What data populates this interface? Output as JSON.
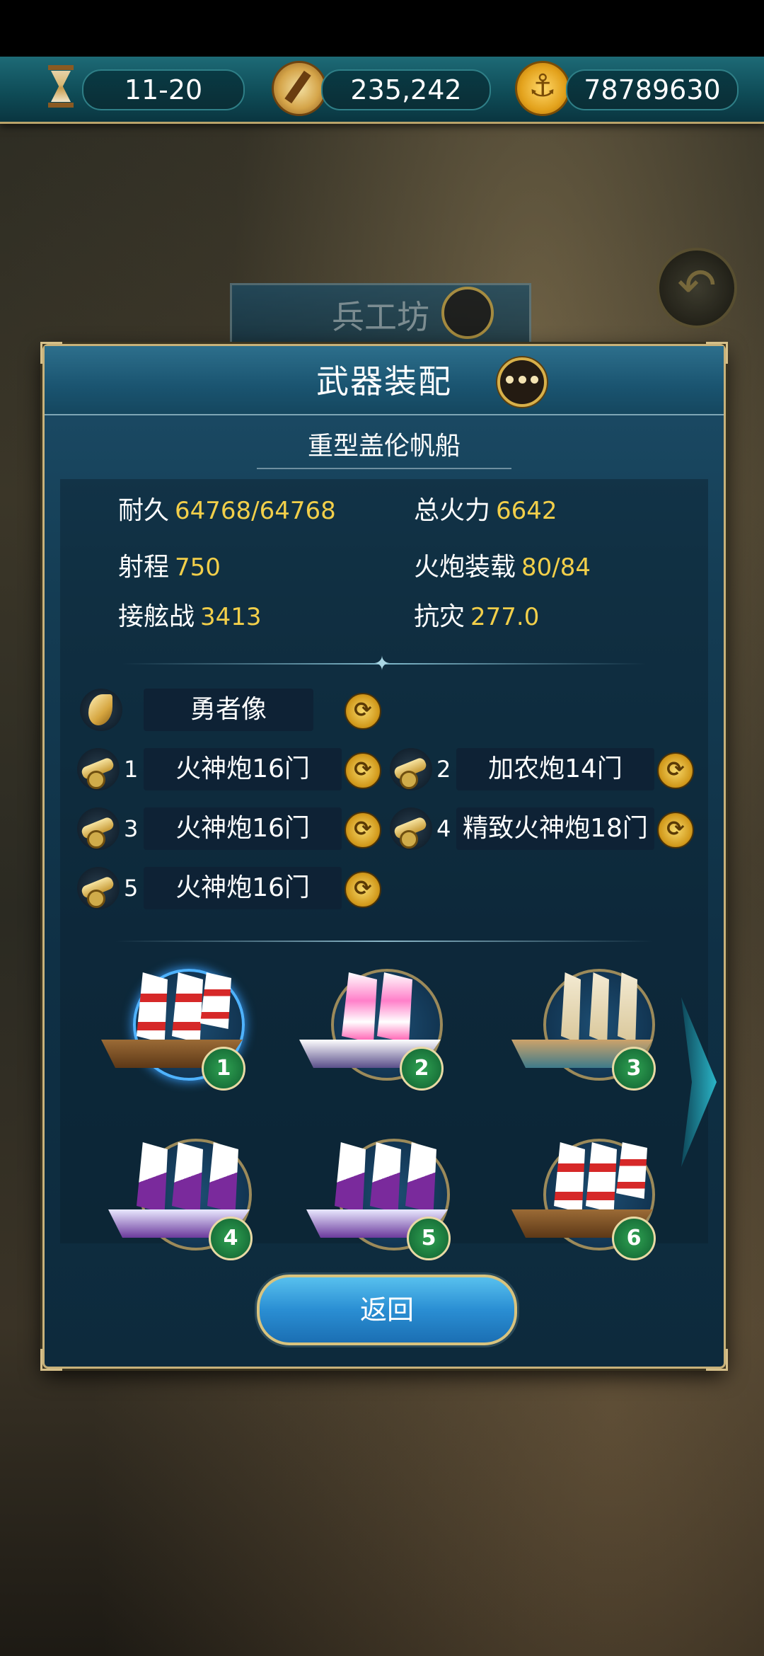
{
  "resources": {
    "turn": "11-20",
    "compass_value": "235,242",
    "gold_value": "78789630"
  },
  "background": {
    "workshop_title": "兵工坊"
  },
  "panel": {
    "title": "武器装配",
    "ship_name": "重型盖伦帆船",
    "stats": [
      {
        "label": "耐久",
        "value": "64768/64768"
      },
      {
        "label": "总火力",
        "value": "6642"
      },
      {
        "label": "射程",
        "value": "750"
      },
      {
        "label": "火炮装载",
        "value": "80/84"
      },
      {
        "label": "接舷战",
        "value": "3413"
      },
      {
        "label": "抗灾",
        "value": "277.0"
      }
    ],
    "figurehead": "勇者像",
    "cannon_slots": [
      {
        "num": "1",
        "name": "火神炮16门"
      },
      {
        "num": "2",
        "name": "加农炮14门"
      },
      {
        "num": "3",
        "name": "火神炮16门"
      },
      {
        "num": "4",
        "name": "精致火神炮18门"
      },
      {
        "num": "5",
        "name": "火神炮16门"
      }
    ],
    "ships": [
      "1",
      "2",
      "3",
      "4",
      "5",
      "6"
    ],
    "return_label": "返回"
  },
  "icons": {
    "turn": "hourglass-icon",
    "compass": "compass-icon",
    "gold": "anchor-coin-icon",
    "refresh": "refresh-icon",
    "cannon": "cannon-icon",
    "figurehead": "wing-icon",
    "chat": "chat-icon",
    "back": "back-arrow-icon"
  },
  "colors": {
    "stat_value": "#f2cf4a",
    "ship_badge": "#2fa152",
    "return_button": "#2a8ed3"
  }
}
